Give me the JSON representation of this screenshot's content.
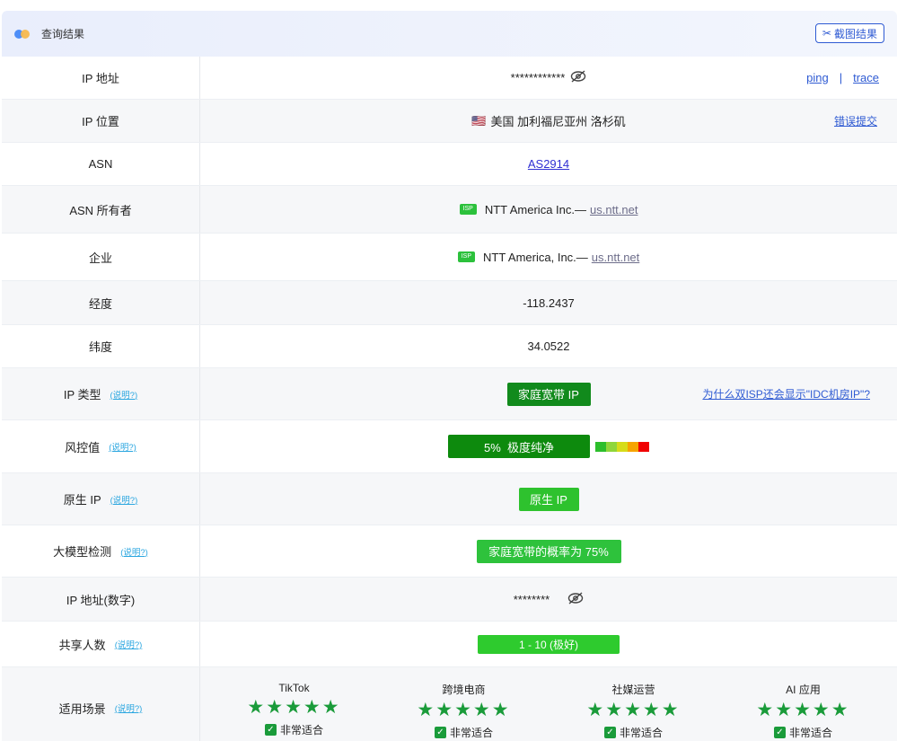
{
  "header": {
    "title": "查询结果",
    "screenshot_label": "截图结果"
  },
  "rows": {
    "ip": {
      "label": "IP 地址",
      "value": "************",
      "ping": "ping",
      "sep": "|",
      "trace": "trace"
    },
    "location": {
      "label": "IP 位置",
      "flag": "🇺🇸",
      "value": "美国 加利福尼亚州 洛杉矶",
      "report": "错误提交"
    },
    "asn": {
      "label": "ASN",
      "value": "AS2914"
    },
    "asn_owner": {
      "label": "ASN 所有者",
      "tag": "ISP",
      "name": "NTT America Inc.—",
      "domain": "us.ntt.net"
    },
    "company": {
      "label": "企业",
      "tag": "ISP",
      "name": "NTT America, Inc.—",
      "domain": "us.ntt.net"
    },
    "longitude": {
      "label": "经度",
      "value": "-118.2437"
    },
    "latitude": {
      "label": "纬度",
      "value": "34.0522"
    },
    "ip_type": {
      "label": "IP 类型",
      "help": "(说明?)",
      "badge": "家庭宽带 IP",
      "link": "为什么双ISP还会显示\"IDC机房IP\"?"
    },
    "risk": {
      "label": "风控值",
      "help": "(说明?)",
      "badge": "5%  极度纯净"
    },
    "native": {
      "label": "原生 IP",
      "help": "(说明?)",
      "badge": "原生 IP"
    },
    "llm": {
      "label": "大模型检测",
      "help": "(说明?)",
      "badge": "家庭宽带的概率为 75%"
    },
    "ip_numeric": {
      "label": "IP 地址(数字)",
      "value": "********"
    },
    "shared": {
      "label": "共享人数",
      "help": "(说明?)",
      "badge": "1 - 10 (极好)"
    },
    "scenes": {
      "label": "适用场景",
      "help": "(说明?)",
      "items": [
        {
          "title": "TikTok",
          "stars": "★★★★★",
          "fit": "非常适合"
        },
        {
          "title": "跨境电商",
          "stars": "★★★★★",
          "fit": "非常适合"
        },
        {
          "title": "社媒运营",
          "stars": "★★★★★",
          "fit": "非常适合"
        },
        {
          "title": "AI 应用",
          "stars": "★★★★★",
          "fit": "非常适合"
        }
      ]
    }
  },
  "colors": {
    "home_badge": "#118a1c",
    "risk_badge": "#0d8a0d",
    "native_badge": "#2ec22e",
    "llm_badge": "#2ec23c",
    "shared_badge": "#2ecb2e",
    "risk_scale": [
      "#2cbe2c",
      "#8fd63a",
      "#d6dc19",
      "#f6a400",
      "#f00000"
    ]
  }
}
